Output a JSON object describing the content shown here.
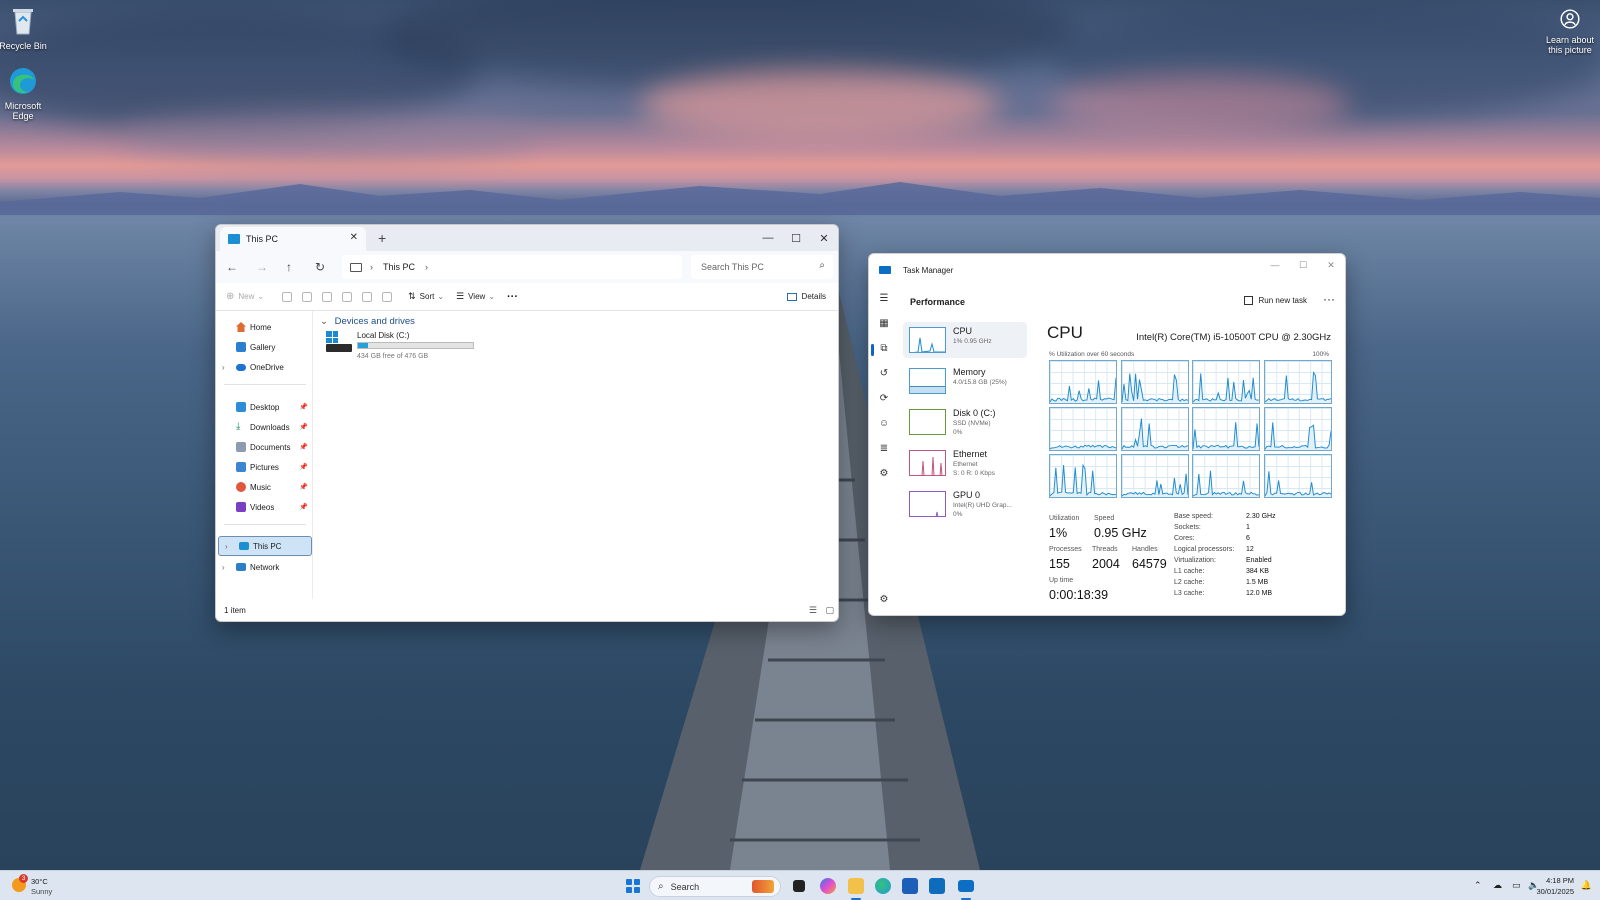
{
  "desktop": {
    "icons": [
      {
        "label": "Recycle Bin"
      },
      {
        "label": "Microsoft Edge"
      }
    ],
    "learn_label": "Learn about this picture"
  },
  "explorer": {
    "tab_title": "This PC",
    "breadcrumb": "This PC",
    "search_placeholder": "Search This PC",
    "commands": {
      "new": "New",
      "sort": "Sort",
      "view": "View",
      "more": "···",
      "details": "Details"
    },
    "sidebar": {
      "home": "Home",
      "gallery": "Gallery",
      "onedrive": "OneDrive",
      "desktop": "Desktop",
      "downloads": "Downloads",
      "documents": "Documents",
      "pictures": "Pictures",
      "music": "Music",
      "videos": "Videos",
      "thispc": "This PC",
      "network": "Network"
    },
    "group_heading": "Devices and drives",
    "drive": {
      "name": "Local Disk (C:)",
      "free_text": "434 GB free of 476 GB",
      "used_fraction": 0.09
    },
    "status": "1 item"
  },
  "taskmgr": {
    "title": "Task Manager",
    "section": "Performance",
    "run_new_task": "Run new task",
    "resources": [
      {
        "name": "CPU",
        "sub": "1%  0.95 GHz",
        "sub2": ""
      },
      {
        "name": "Memory",
        "sub": "4.0/15.8 GB (25%)",
        "sub2": ""
      },
      {
        "name": "Disk 0 (C:)",
        "sub": "SSD (NVMe)",
        "sub2": "0%"
      },
      {
        "name": "Ethernet",
        "sub": "Ethernet",
        "sub2": "S: 0 R: 0 Kbps"
      },
      {
        "name": "GPU 0",
        "sub": "Intel(R) UHD Grap...",
        "sub2": "0%"
      }
    ],
    "cpu": {
      "title": "CPU",
      "model": "Intel(R) Core(TM) i5-10500T CPU @ 2.30GHz",
      "graph_label": "% Utilization over 60 seconds",
      "graph_max": "100%",
      "cores": 12
    },
    "stats": {
      "utilization_label": "Utilization",
      "utilization": "1%",
      "speed_label": "Speed",
      "speed": "0.95 GHz",
      "processes_label": "Processes",
      "processes": "155",
      "threads_label": "Threads",
      "threads": "2004",
      "handles_label": "Handles",
      "handles": "64579",
      "uptime_label": "Up time",
      "uptime": "0:00:18:39"
    },
    "specs": [
      {
        "label": "Base speed:",
        "value": "2.30 GHz"
      },
      {
        "label": "Sockets:",
        "value": "1"
      },
      {
        "label": "Cores:",
        "value": "6"
      },
      {
        "label": "Logical processors:",
        "value": "12"
      },
      {
        "label": "Virtualization:",
        "value": "Enabled"
      },
      {
        "label": "L1 cache:",
        "value": "384 KB"
      },
      {
        "label": "L2 cache:",
        "value": "1.5 MB"
      },
      {
        "label": "L3 cache:",
        "value": "12.0 MB"
      }
    ]
  },
  "taskbar": {
    "weather_badge": "3",
    "weather_temp": "30°C",
    "weather_desc": "Sunny",
    "search_label": "Search",
    "time": "4:18 PM",
    "date": "30/01/2025"
  }
}
